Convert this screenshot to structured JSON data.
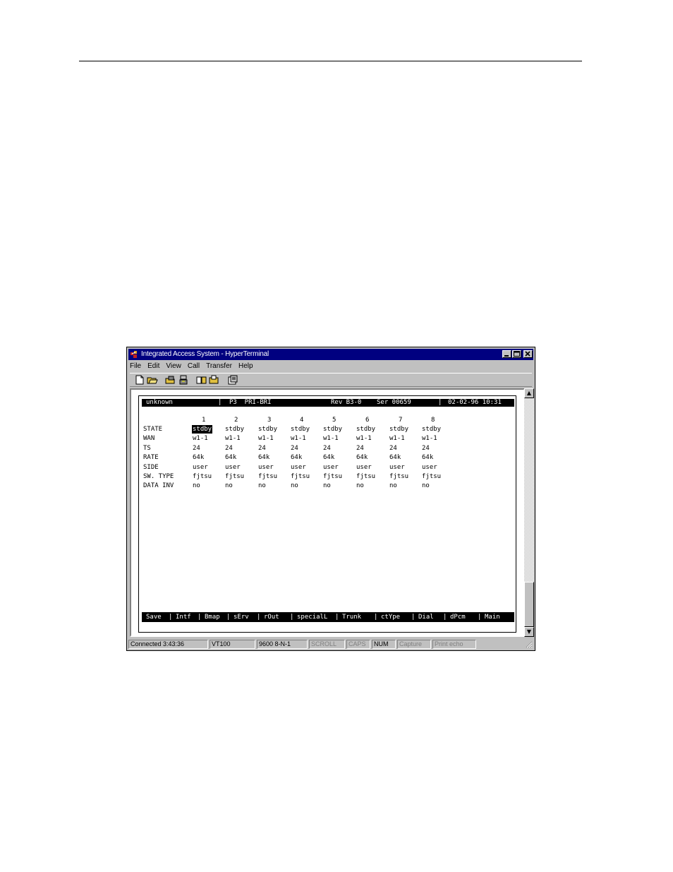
{
  "window": {
    "title": "Integrated Access System - HyperTerminal"
  },
  "menu": [
    "File",
    "Edit",
    "View",
    "Call",
    "Transfer",
    "Help"
  ],
  "toolbar": {
    "buttons": [
      "new-icon",
      "open-icon",
      "connect-icon",
      "disconnect-icon",
      "send-icon",
      "receive-icon",
      "properties-icon"
    ]
  },
  "terminal": {
    "header": {
      "name": "unknown",
      "sep1": "|",
      "module": "P3  PRI-BRI",
      "rev": "Rev B3-0",
      "ser": "Ser 00659",
      "sep2": "|",
      "datetime": "02-02-96 10:31"
    },
    "columns": [
      "1",
      "2",
      "3",
      "4",
      "5",
      "6",
      "7",
      "8"
    ],
    "rows": [
      {
        "label": "STATE",
        "values": [
          "stdby",
          "stdby",
          "stdby",
          "stdby",
          "stdby",
          "stdby",
          "stdby",
          "stdby"
        ]
      },
      {
        "label": "WAN",
        "values": [
          "w1-1",
          "w1-1",
          "w1-1",
          "w1-1",
          "w1-1",
          "w1-1",
          "w1-1",
          "w1-1"
        ]
      },
      {
        "label": "TS",
        "values": [
          "24",
          "24",
          "24",
          "24",
          "24",
          "24",
          "24",
          "24"
        ]
      },
      {
        "label": "RATE",
        "values": [
          "64k",
          "64k",
          "64k",
          "64k",
          "64k",
          "64k",
          "64k",
          "64k"
        ]
      },
      {
        "label": "SIDE",
        "values": [
          "user",
          "user",
          "user",
          "user",
          "user",
          "user",
          "user",
          "user"
        ]
      },
      {
        "label": "SW. TYPE",
        "values": [
          "fjtsu",
          "fjtsu",
          "fjtsu",
          "fjtsu",
          "fjtsu",
          "fjtsu",
          "fjtsu",
          "fjtsu"
        ]
      },
      {
        "label": "DATA INV",
        "values": [
          "no",
          "no",
          "no",
          "no",
          "no",
          "no",
          "no",
          "no"
        ]
      }
    ],
    "commands": [
      "Save",
      "Intf",
      "Bmap",
      "sErv",
      "rOut",
      "specialL",
      "Trunk",
      "ctYpe",
      "Dial",
      "dPcm",
      "Main"
    ]
  },
  "statusbar": {
    "connected": "Connected 3:43:36",
    "emulation": "VT100",
    "settings": "9600 8-N-1",
    "scroll": "SCROLL",
    "caps": "CAPS",
    "num": "NUM",
    "capture": "Capture",
    "print_echo": "Print echo"
  }
}
